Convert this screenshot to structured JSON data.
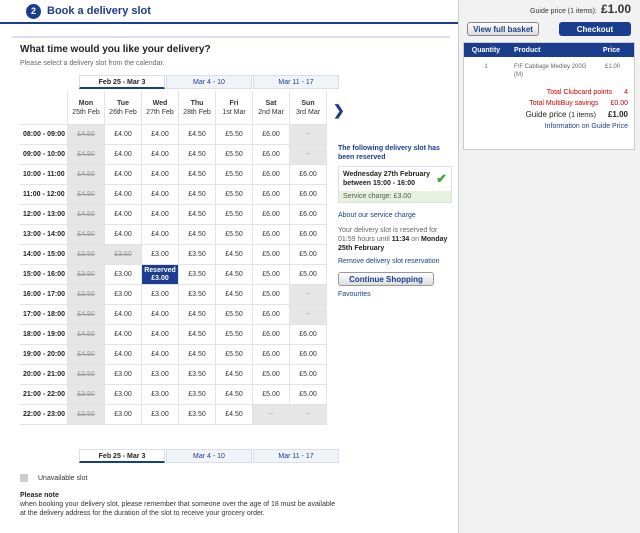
{
  "step": {
    "number": "2",
    "title": "Book a delivery slot"
  },
  "question": {
    "title": "What time would you like your delivery?",
    "subtitle": "Please select a delivery slot from the calendar."
  },
  "weeks": [
    "Feb 25 - Mar 3",
    "Mar 4 - 10",
    "Mar 11 - 17"
  ],
  "days": [
    {
      "day": "Mon",
      "date": "25th Feb"
    },
    {
      "day": "Tue",
      "date": "26th Feb"
    },
    {
      "day": "Wed",
      "date": "27th Feb"
    },
    {
      "day": "Thu",
      "date": "28th Feb"
    },
    {
      "day": "Fri",
      "date": "1st Mar"
    },
    {
      "day": "Sat",
      "date": "2nd Mar"
    },
    {
      "day": "Sun",
      "date": "3rd Mar"
    }
  ],
  "slots": [
    {
      "time": "08:00 - 09:00",
      "cells": [
        "u:£4.50",
        "£4.00",
        "£4.00",
        "£4.50",
        "£5.50",
        "£6.00",
        "d:--"
      ]
    },
    {
      "time": "09:00 - 10:00",
      "cells": [
        "u:£4.50",
        "£4.00",
        "£4.00",
        "£4.50",
        "£5.50",
        "£6.00",
        "d:--"
      ]
    },
    {
      "time": "10:00 - 11:00",
      "cells": [
        "u:£4.50",
        "£4.00",
        "£4.00",
        "£4.50",
        "£5.50",
        "£6.00",
        "£6.00"
      ]
    },
    {
      "time": "11:00 - 12:00",
      "cells": [
        "u:£4.50",
        "£4.00",
        "£4.00",
        "£4.50",
        "£5.50",
        "£6.00",
        "£6.00"
      ]
    },
    {
      "time": "12:00 - 13:00",
      "cells": [
        "u:£4.50",
        "£4.00",
        "£4.00",
        "£4.50",
        "£5.50",
        "£6.00",
        "£6.00"
      ]
    },
    {
      "time": "13:00 - 14:00",
      "cells": [
        "u:£4.50",
        "£4.00",
        "£4.00",
        "£4.50",
        "£5.50",
        "£6.00",
        "£6.00"
      ]
    },
    {
      "time": "14:00 - 15:00",
      "cells": [
        "u:£3.50",
        "u:£3.50",
        "£3.00",
        "£3.50",
        "£4.50",
        "£5.00",
        "£5.00"
      ]
    },
    {
      "time": "15:00 - 16:00",
      "cells": [
        "u:£3.50",
        "£3.00",
        "r:£3.00",
        "£3.50",
        "£4.50",
        "£5.00",
        "£5.00"
      ]
    },
    {
      "time": "16:00 - 17:00",
      "cells": [
        "u:£3.50",
        "£3.00",
        "£3.00",
        "£3.50",
        "£4.50",
        "£5.00",
        "d:--"
      ]
    },
    {
      "time": "17:00 - 18:00",
      "cells": [
        "u:£4.50",
        "£4.00",
        "£4.00",
        "£4.50",
        "£5.50",
        "£6.00",
        "d:--"
      ]
    },
    {
      "time": "18:00 - 19:00",
      "cells": [
        "u:£4.50",
        "£4.00",
        "£4.00",
        "£4.50",
        "£5.50",
        "£6.00",
        "£6.00"
      ]
    },
    {
      "time": "19:00 - 20:00",
      "cells": [
        "u:£4.50",
        "£4.00",
        "£4.00",
        "£4.50",
        "£5.50",
        "£6.00",
        "£6.00"
      ]
    },
    {
      "time": "20:00 - 21:00",
      "cells": [
        "u:£3.50",
        "£3.00",
        "£3.00",
        "£3.50",
        "£4.50",
        "£5.00",
        "£5.00"
      ]
    },
    {
      "time": "21:00 - 22:00",
      "cells": [
        "u:£3.50",
        "£3.00",
        "£3.00",
        "£3.50",
        "£4.50",
        "£5.00",
        "£5.00"
      ]
    },
    {
      "time": "22:00 - 23:00",
      "cells": [
        "u:£3.50",
        "£3.00",
        "£3.00",
        "£3.50",
        "£4.50",
        "d:--",
        "d:--"
      ]
    }
  ],
  "reserved_label": "Reserved",
  "info": {
    "title": "The following delivery slot has been reserved",
    "when": "Wednesday 27th February between 15:00 - 16:00",
    "charge": "Service charge: £3.00",
    "service_link": "About our service charge",
    "reserved_text": "Your delivery slot is reserved for 01:59 hours until",
    "reserved_time": "11:34",
    "reserved_on": "on",
    "reserved_date": "Monday 25th February",
    "remove_link": "Remove delivery slot reservation",
    "continue_button": "Continue Shopping",
    "favourites_link": "Favourites"
  },
  "legend": {
    "unavailable": "Unavailable slot"
  },
  "note": {
    "title": "Please note",
    "text": "when booking your delivery slot, please remember that someone over the age of 18 must be available at the delivery address for the duration of the slot to receive your grocery order."
  },
  "sidebar": {
    "guide_top_label": "Guide price (1 items):",
    "guide_top_value": "£1.00",
    "view_basket": "View full basket",
    "checkout": "Checkout",
    "columns": [
      "Quantity",
      "Product",
      "Price"
    ],
    "item": {
      "qty": "1",
      "product": "F/F Cabbage Medley 200G (M)",
      "price": "£1.00"
    },
    "clubcard_label": "Total Clubcard points",
    "clubcard_value": "4",
    "multibuy_label": "Total MultiBuy savings",
    "multibuy_value": "£0.00",
    "guide_label": "Guide price",
    "guide_items": "(1 items)",
    "guide_value": "£1.00",
    "info_link": "Information on Guide Price"
  },
  "colors": {
    "brand": "#1a3d8f",
    "unavailable": "#e6e6e6",
    "success": "#3aa83a",
    "savings": "#cc0000"
  }
}
